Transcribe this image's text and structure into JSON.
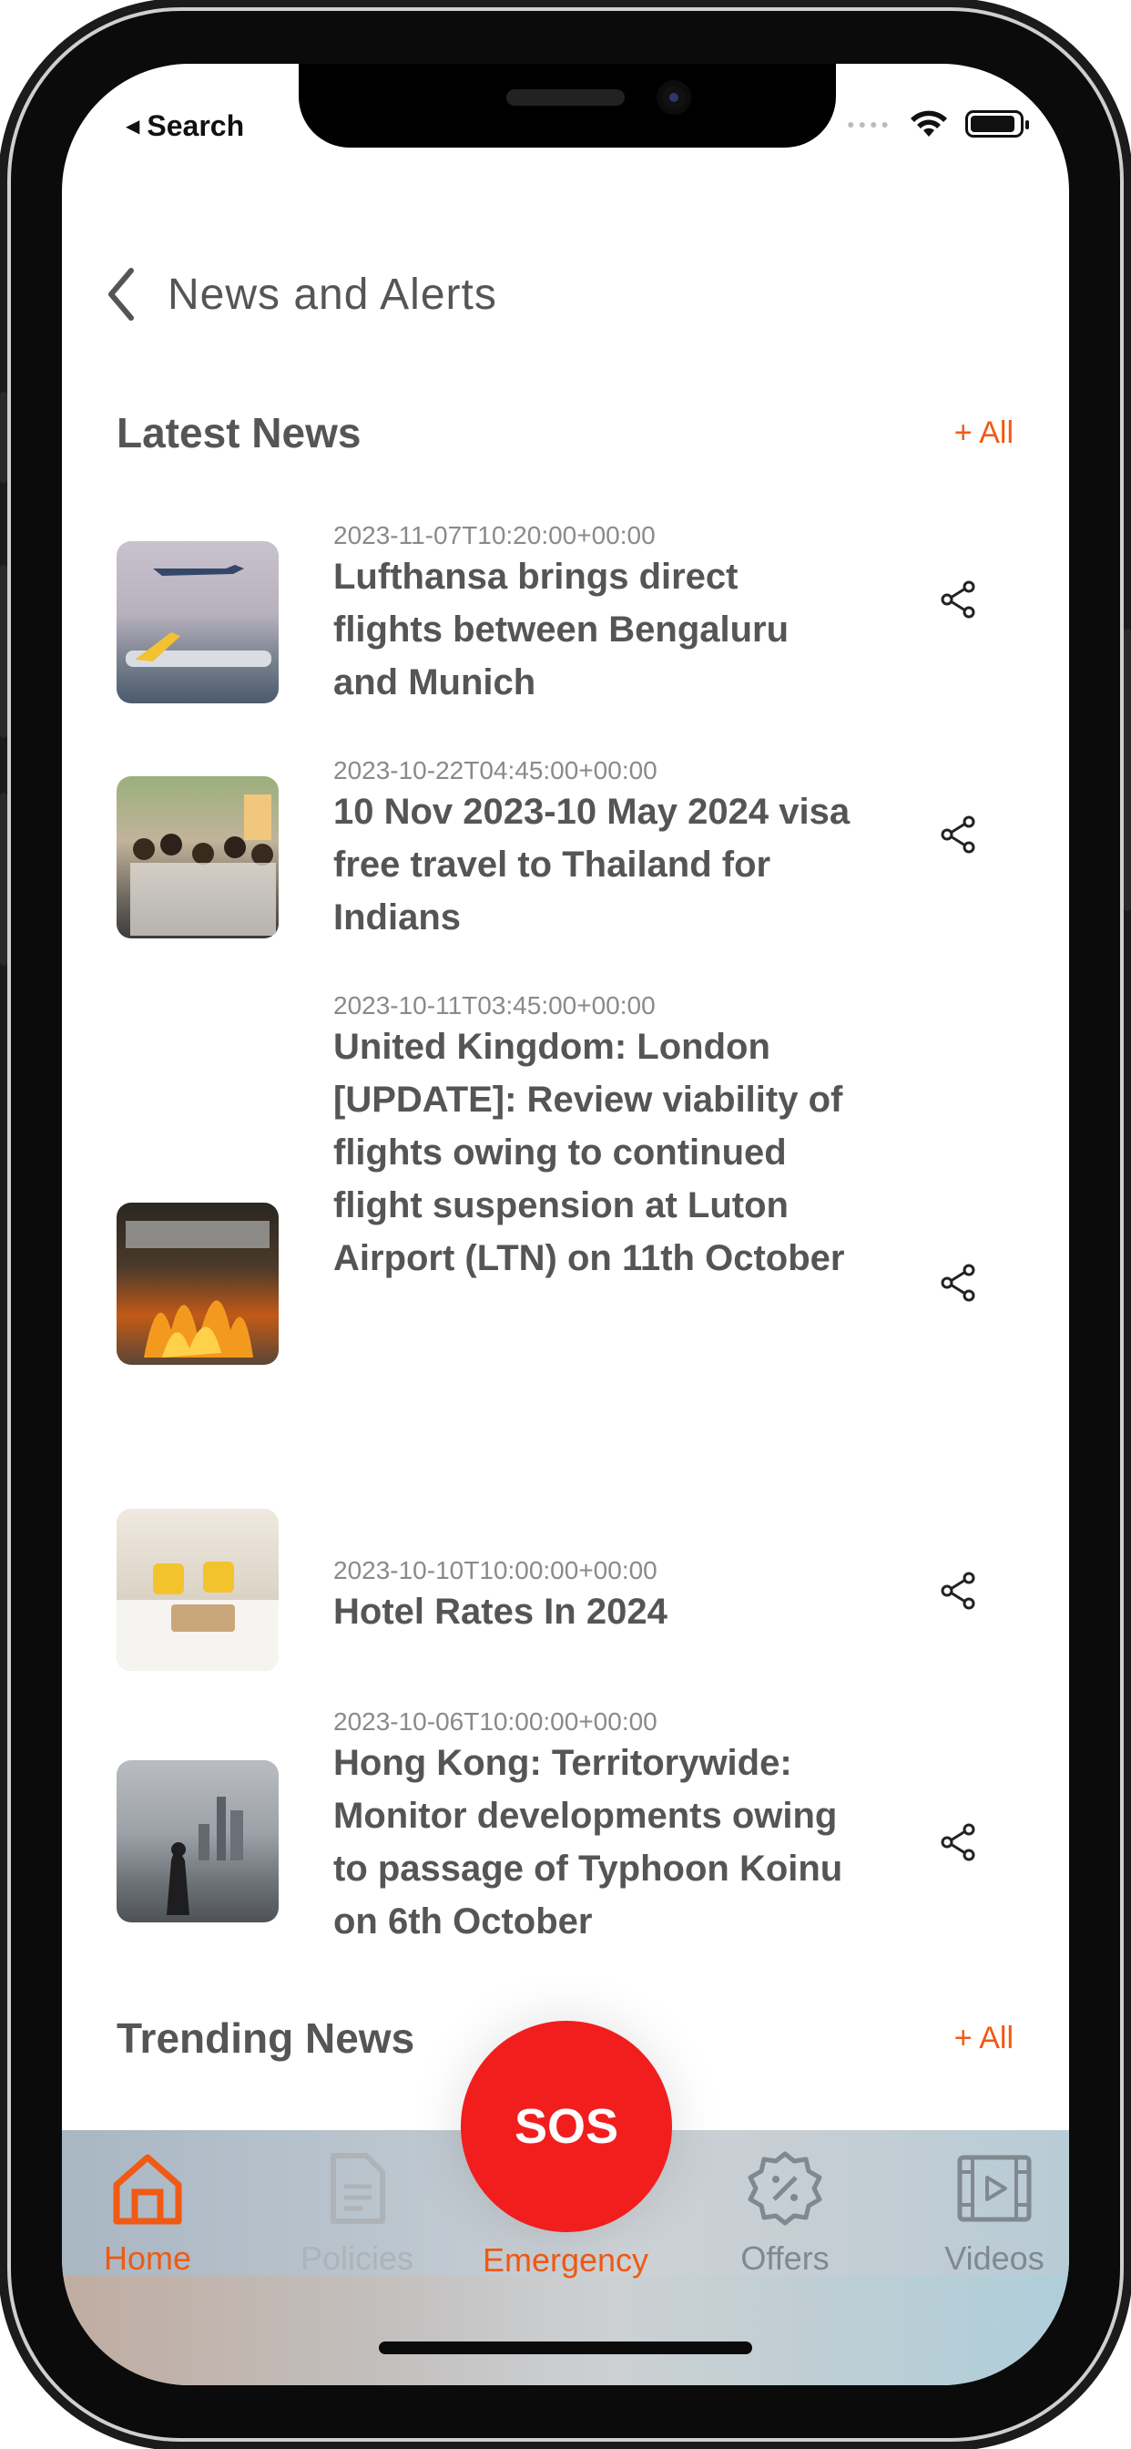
{
  "status_bar": {
    "back_app": "Search"
  },
  "header": {
    "title": "News and Alerts"
  },
  "latest_news": {
    "title": "Latest News",
    "see_all": "+ All",
    "items": [
      {
        "date": "2023-11-07T10:20:00+00:00",
        "title": "Lufthansa brings direct flights between Bengaluru and Munich"
      },
      {
        "date": "2023-10-22T04:45:00+00:00",
        "title": "10 Nov 2023-10 May 2024 visa free travel to Thailand for Indians"
      },
      {
        "date": "2023-10-11T03:45:00+00:00",
        "title": "United Kingdom: London [UPDATE]: Review viability of flights owing to continued flight suspension at Luton Airport (LTN) on 11th October"
      },
      {
        "date": "2023-10-10T10:00:00+00:00",
        "title": "Hotel Rates In 2024"
      },
      {
        "date": "2023-10-06T10:00:00+00:00",
        "title": "Hong Kong: Territorywide: Monitor developments owing to passage of Typhoon Koinu on 6th October"
      }
    ]
  },
  "trending_news": {
    "title": "Trending News",
    "see_all": "+ All"
  },
  "sos_button": "SOS",
  "tabbar": {
    "items": [
      {
        "label": "Home",
        "icon": "home-icon",
        "active": true
      },
      {
        "label": "Policies",
        "icon": "document-icon",
        "active": false
      },
      {
        "label": "Emergency",
        "icon": "sos-icon",
        "active": true
      },
      {
        "label": "Offers",
        "icon": "discount-badge-icon",
        "active": false
      },
      {
        "label": "Videos",
        "icon": "video-icon",
        "active": false
      }
    ]
  },
  "colors": {
    "accent": "#f05a14",
    "sos": "#f21e1e",
    "text": "#555555",
    "muted": "#8a8a8a"
  }
}
